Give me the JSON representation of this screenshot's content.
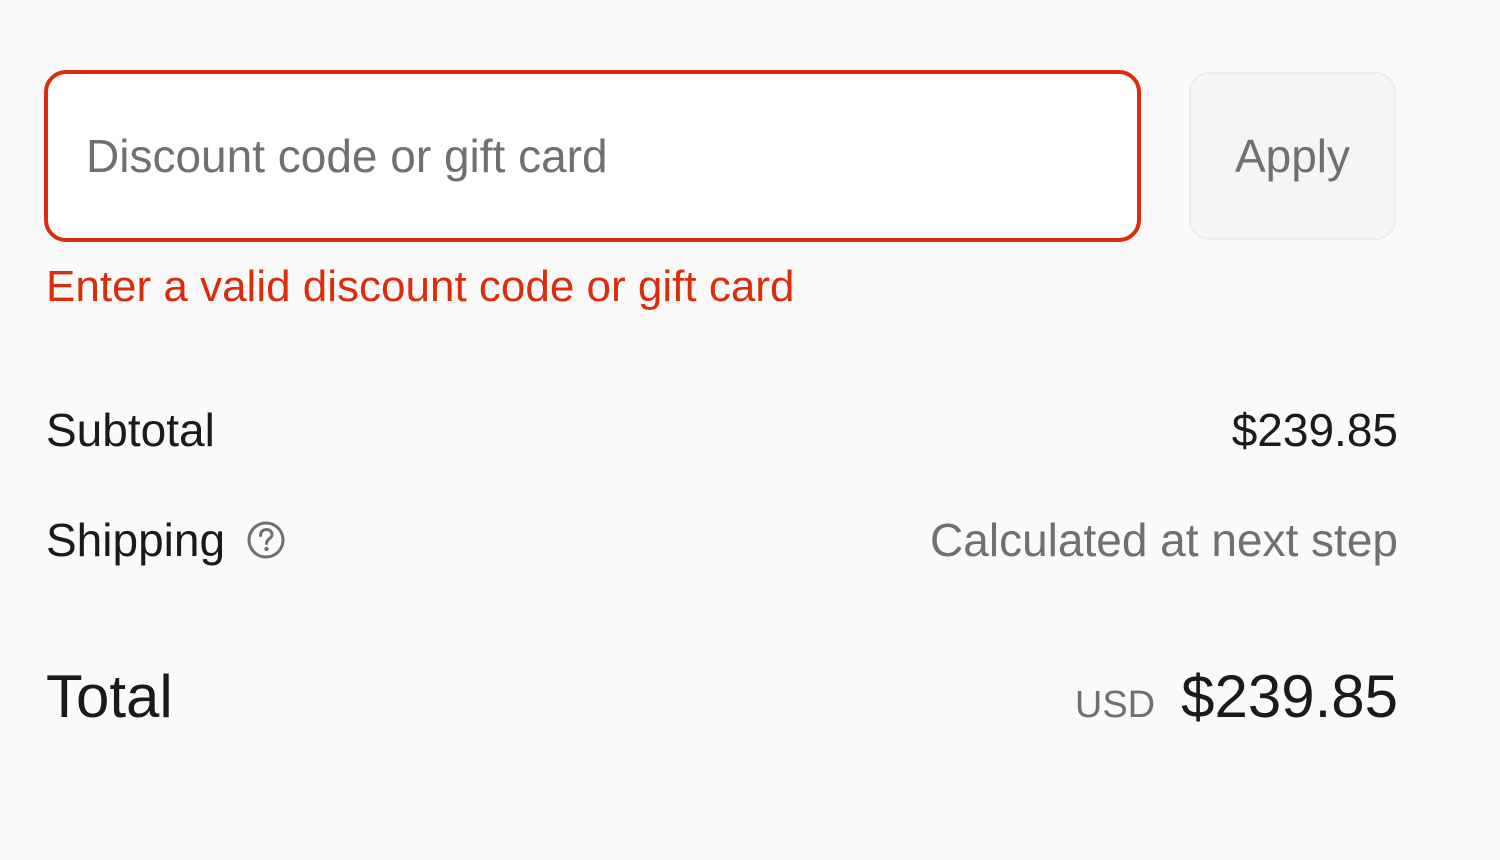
{
  "discount": {
    "placeholder": "Discount code or gift card",
    "value": "",
    "apply_label": "Apply",
    "error": "Enter a valid discount code or gift card"
  },
  "summary": {
    "subtotal_label": "Subtotal",
    "subtotal_value": "$239.85",
    "shipping_label": "Shipping",
    "shipping_value": "Calculated at next step",
    "shipping_icon": "question-circle-icon",
    "total_label": "Total",
    "currency": "USD",
    "total_value": "$239.85"
  },
  "colors": {
    "error": "#dd2c0a",
    "muted_text": "#707070",
    "text": "#1a1a1a",
    "background": "#fafafa"
  }
}
